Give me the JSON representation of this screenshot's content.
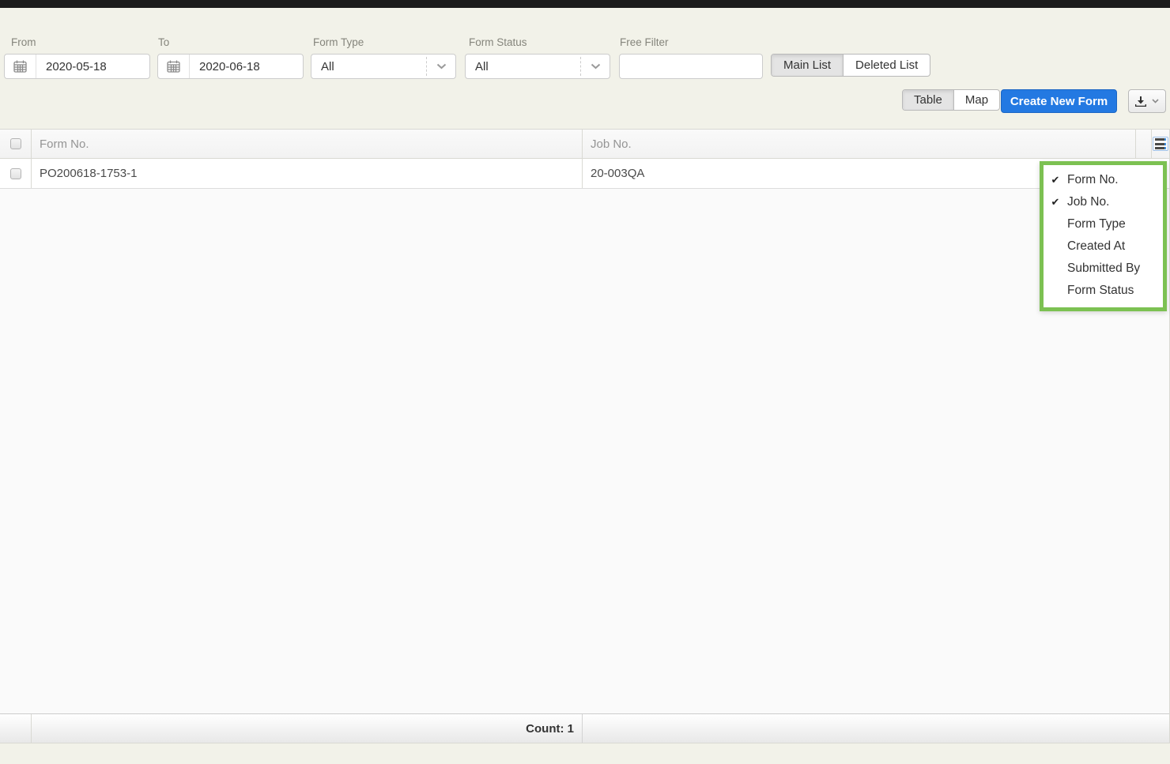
{
  "filters": {
    "from": {
      "label": "From",
      "value": "2020-05-18"
    },
    "to": {
      "label": "To",
      "value": "2020-06-18"
    },
    "form_type": {
      "label": "Form Type",
      "value": "All"
    },
    "form_status": {
      "label": "Form Status",
      "value": "All"
    },
    "free_filter": {
      "label": "Free Filter",
      "value": "",
      "placeholder": ""
    },
    "list_toggle": {
      "main_label": "Main List",
      "deleted_label": "Deleted List",
      "active": "Main List"
    }
  },
  "toolbar": {
    "view_toggle": {
      "table_label": "Table",
      "map_label": "Map",
      "active": "Table"
    },
    "create_label": "Create New Form",
    "download_icon": "download-icon",
    "download_caret_icon": "chevron-down-icon"
  },
  "table": {
    "columns": {
      "form_no": "Form No.",
      "job_no": "Job No."
    },
    "rows": [
      {
        "form_no": "PO200618-1753-1",
        "job_no": "20-003QA"
      }
    ],
    "footer": {
      "count_text": "Count: 1"
    }
  },
  "column_menu": {
    "items": [
      {
        "label": "Form No.",
        "checked": true
      },
      {
        "label": "Job No.",
        "checked": true
      },
      {
        "label": "Form Type",
        "checked": false
      },
      {
        "label": "Created At",
        "checked": false
      },
      {
        "label": "Submitted By",
        "checked": false
      },
      {
        "label": "Form Status",
        "checked": false
      }
    ],
    "check_glyph": "✔"
  },
  "colors": {
    "accent_blue": "#2379e2",
    "highlight_green": "#7cc152",
    "topbar_black": "#1c1c1c",
    "page_background": "#f2f2e9"
  }
}
